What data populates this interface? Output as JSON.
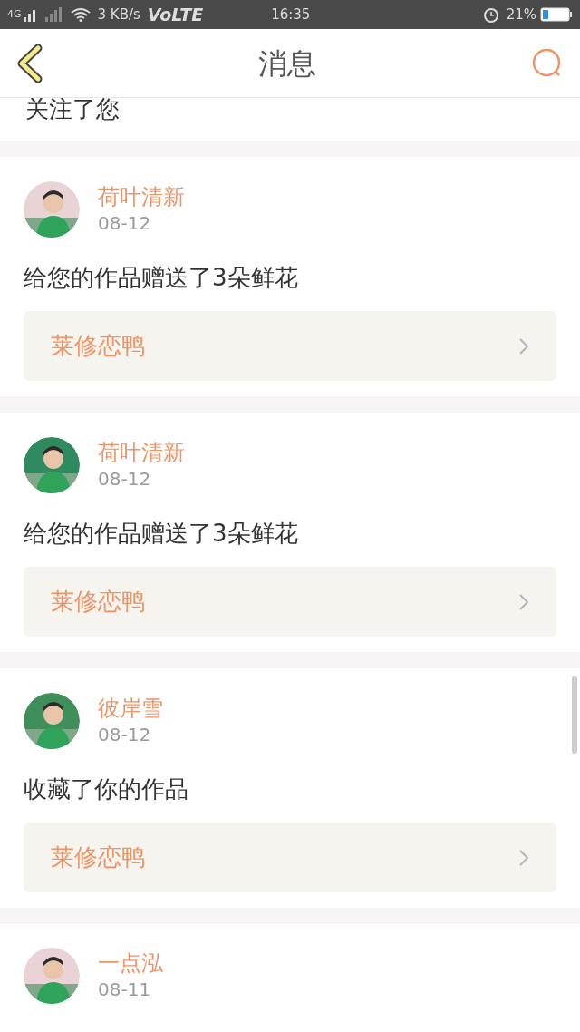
{
  "status_bar": {
    "network": "4G",
    "speed": "3 KB/s",
    "volte": "VoLTE",
    "time": "16:35",
    "battery": "21%"
  },
  "header": {
    "title": "消息"
  },
  "messages": [
    {
      "kind": "partial",
      "text": "关注了您"
    },
    {
      "kind": "full",
      "name": "荷叶清新",
      "date": "08-12",
      "text": "给您的作品赠送了3朵鲜花",
      "work": "莱修恋鸭"
    },
    {
      "kind": "full",
      "name": "荷叶清新",
      "date": "08-12",
      "text": "给您的作品赠送了3朵鲜花",
      "work": "莱修恋鸭"
    },
    {
      "kind": "full",
      "name": "彼岸雪",
      "date": "08-12",
      "text": "收藏了你的作品",
      "work": "莱修恋鸭"
    },
    {
      "kind": "head",
      "name": "一点泓",
      "date": "08-11"
    }
  ]
}
